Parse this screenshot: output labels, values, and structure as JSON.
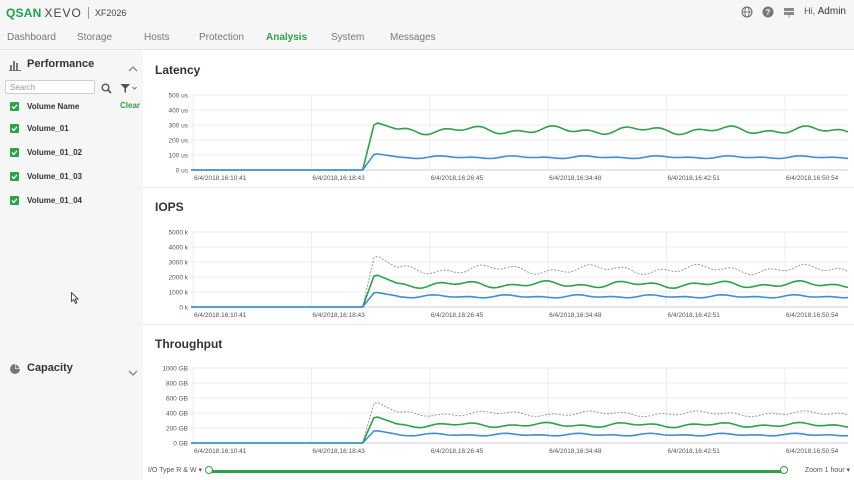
{
  "app": {
    "brand": "QSAN",
    "product": "XEVO",
    "model": "XF2026",
    "greeting": "Hi,",
    "user": "Admin"
  },
  "nav": {
    "tabs": [
      {
        "label": "Dashboard",
        "active": false
      },
      {
        "label": "Storage",
        "active": false
      },
      {
        "label": "Hosts",
        "active": false
      },
      {
        "label": "Protection",
        "active": false
      },
      {
        "label": "Analysis",
        "active": true
      },
      {
        "label": "System",
        "active": false
      },
      {
        "label": "Messages",
        "active": false
      }
    ]
  },
  "sidebar": {
    "performance_title": "Performance",
    "search_placeholder": "Search",
    "header_label": "Volume Name",
    "clear_label": "Clear",
    "volumes": [
      {
        "label": "Volume_01",
        "checked": true
      },
      {
        "label": "Volume_01_02",
        "checked": true
      },
      {
        "label": "Volume_01_03",
        "checked": true
      },
      {
        "label": "Volume_01_04",
        "checked": true
      }
    ],
    "capacity_title": "Capacity"
  },
  "colors": {
    "accent": "#2ea24a",
    "series_green": "#2ea24a",
    "series_blue": "#3b8fdc",
    "series_gray": "#9a9a9a"
  },
  "x_labels": [
    "6/4/2018,16:10:41",
    "6/4/2018,16:18:43",
    "6/4/2018,16:26:45",
    "6/4/2018,16:34:48",
    "6/4/2018,16:42:51",
    "6/4/2018,16:50:54"
  ],
  "chart_data": [
    {
      "type": "line",
      "title": "Latency",
      "y_ticks": [
        "500 us",
        "400 us",
        "300 us",
        "200 us",
        "100 us",
        "0 us"
      ],
      "ylim": [
        0,
        500
      ],
      "x_range_minutes": [
        0,
        44
      ],
      "series": [
        {
          "color": "#2ea24a",
          "dashed": false,
          "onset": 11.5,
          "peak": 320,
          "level": 265,
          "wobble": 30,
          "step": 1.1
        },
        {
          "color": "#3b8fdc",
          "dashed": false,
          "onset": 11.5,
          "peak": 110,
          "level": 85,
          "wobble": 10,
          "step": 1.3
        }
      ]
    },
    {
      "type": "line",
      "title": "IOPS",
      "y_ticks": [
        "5000 k",
        "4000 k",
        "3000 k",
        "2000 k",
        "1000 k",
        "0 k"
      ],
      "ylim": [
        0,
        5000
      ],
      "x_range_minutes": [
        0,
        44
      ],
      "series": [
        {
          "color": "#9a9a9a",
          "dashed": true,
          "onset": 11.5,
          "peak": 3500,
          "level": 2500,
          "wobble": 350,
          "step": 0.9
        },
        {
          "color": "#2ea24a",
          "dashed": false,
          "onset": 11.5,
          "peak": 2200,
          "level": 1500,
          "wobble": 250,
          "step": 1.1
        },
        {
          "color": "#3b8fdc",
          "dashed": false,
          "onset": 11.5,
          "peak": 1000,
          "level": 700,
          "wobble": 120,
          "step": 1.3
        }
      ]
    },
    {
      "type": "line",
      "title": "Throughput",
      "y_ticks": [
        "1000 GB",
        "800 GB",
        "600 GB",
        "400 GB",
        "200 GB",
        "0 GB"
      ],
      "ylim": [
        0,
        1000
      ],
      "x_range_minutes": [
        0,
        44
      ],
      "series": [
        {
          "color": "#9a9a9a",
          "dashed": true,
          "onset": 11.5,
          "peak": 560,
          "level": 390,
          "wobble": 40,
          "step": 0.9
        },
        {
          "color": "#2ea24a",
          "dashed": false,
          "onset": 11.5,
          "peak": 360,
          "level": 240,
          "wobble": 35,
          "step": 1.1
        },
        {
          "color": "#3b8fdc",
          "dashed": false,
          "onset": 11.5,
          "peak": 170,
          "level": 110,
          "wobble": 20,
          "step": 1.3
        }
      ]
    }
  ],
  "footer": {
    "io_type_label": "I/O Type R & W",
    "zoom_label": "Zoom 1 hour"
  }
}
